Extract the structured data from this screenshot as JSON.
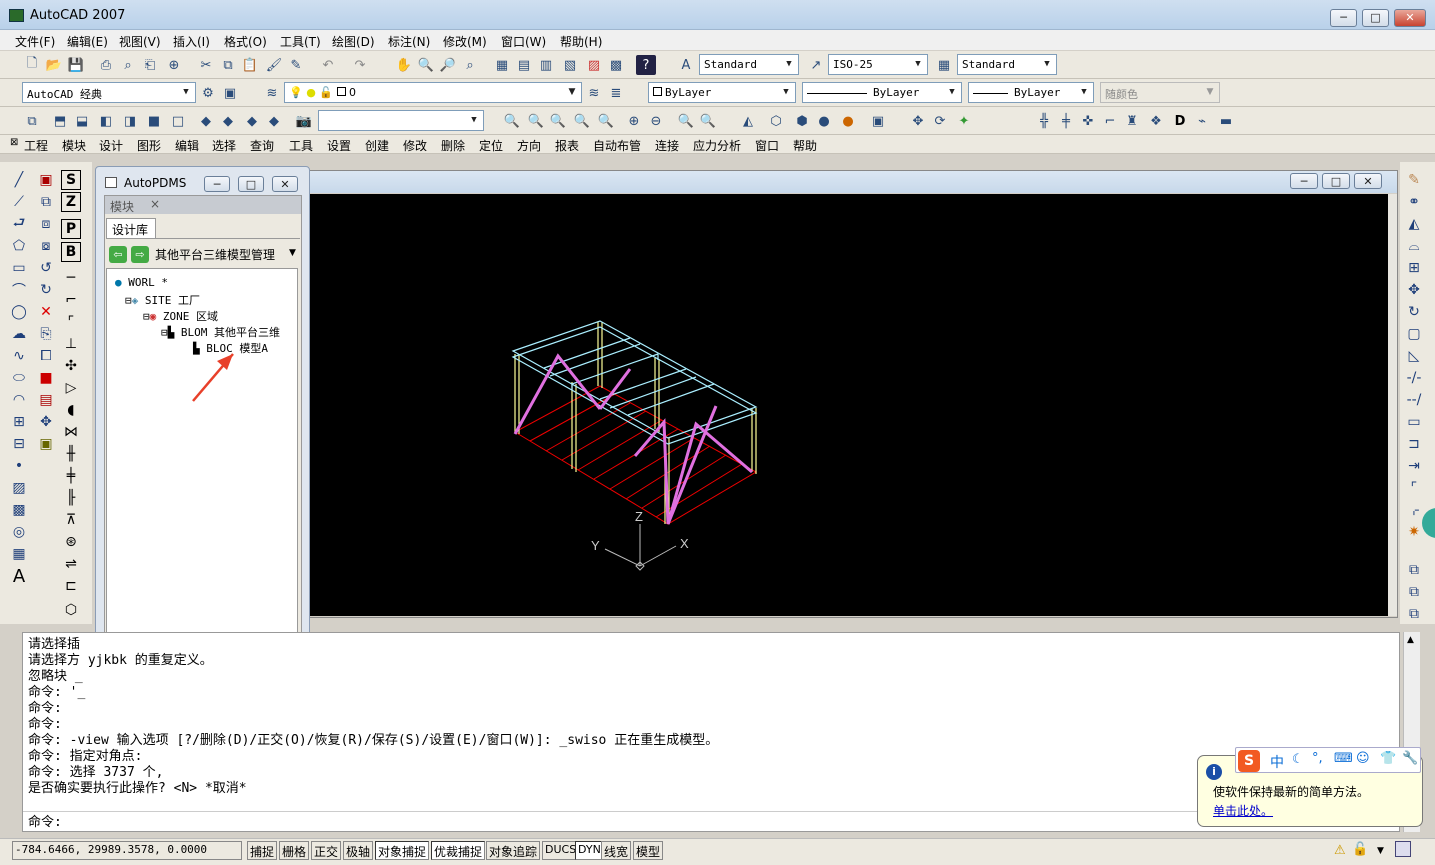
{
  "window": {
    "title": "AutoCAD 2007",
    "min": "─",
    "max": "□",
    "close": "✕"
  },
  "menu": [
    "文件(F)",
    "编辑(E)",
    "视图(V)",
    "插入(I)",
    "格式(O)",
    "工具(T)",
    "绘图(D)",
    "标注(N)",
    "修改(M)",
    "窗口(W)",
    "帮助(H)"
  ],
  "toolbar1": {
    "text_style": "Standard",
    "dim_style": "ISO-25",
    "table_style": "Standard"
  },
  "toolbar2": {
    "workspace": "AutoCAD 经典",
    "layer": "0",
    "color": "ByLayer",
    "linetype": "ByLayer",
    "lineweight": "ByLayer",
    "plotstyle": "随颜色"
  },
  "pdms_menu": [
    "工程",
    "模块",
    "设计",
    "图形",
    "编辑",
    "选择",
    "查询",
    "工具",
    "设置",
    "创建",
    "修改",
    "删除",
    "定位",
    "方向",
    "报表",
    "自动布管",
    "连接",
    "应力分析",
    "窗口",
    "帮助"
  ],
  "pdms_panel": {
    "title": "AutoPDMS",
    "section": "模块",
    "section_close": "×",
    "tab": "设计库",
    "dropdown": "其他平台三维模型管理",
    "tree": [
      {
        "text": "WORL *",
        "level": 0
      },
      {
        "text": "SITE 工厂",
        "level": 1
      },
      {
        "text": "ZONE 区域",
        "level": 2
      },
      {
        "text": "BLOM 其他平台三维",
        "level": 3
      },
      {
        "text": "BLOC 模型A",
        "level": 4
      }
    ]
  },
  "axes": {
    "x": "X",
    "y": "Y",
    "z": "Z"
  },
  "command_lines": [
    "请选择插",
    "请选择方                     yjkbk 的重复定义。",
    "忽略块 _",
    "命令: '_",
    "命令:",
    "命令:",
    "命令:  -view 输入选项 [?/删除(D)/正交(O)/恢复(R)/保存(S)/设置(E)/窗口(W)]: _swiso 正在重生成模型。",
    "命令: 指定对角点:",
    "命令: 选择 3737 个,",
    "是否确实要执行此操作? <N> *取消*"
  ],
  "command_prompt": "命令:",
  "status": {
    "coords": "-784.6466,  29989.3578, 0.0000",
    "buttons": [
      "捕捉",
      "栅格",
      "正交",
      "极轴",
      "对象捕捉",
      "优裁捕捉",
      "对象追踪",
      "DUCS",
      "DYN",
      "线宽",
      "模型"
    ]
  },
  "balloon": {
    "text": "使软件保持最新的简单方法。",
    "link": "单击此处。"
  },
  "ime": {
    "label": "中"
  }
}
